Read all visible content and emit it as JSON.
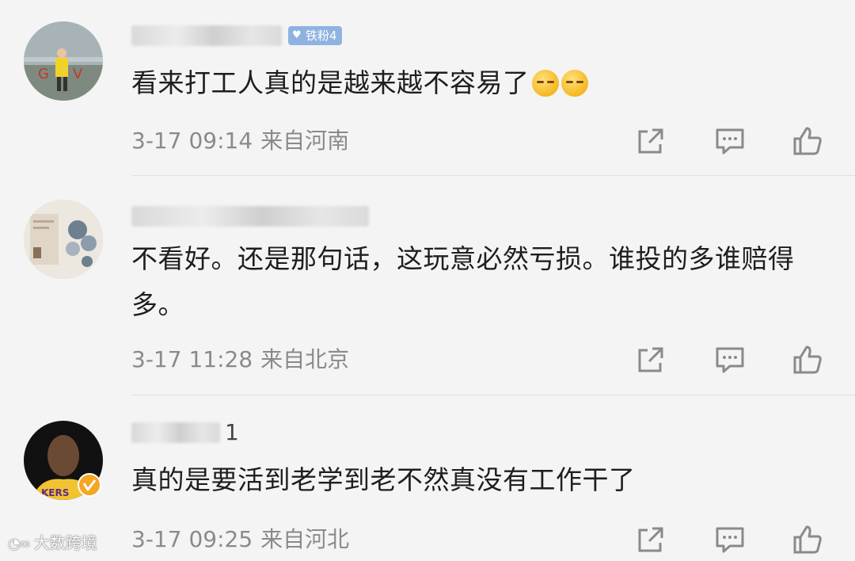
{
  "comments": [
    {
      "badge": "铁粉4",
      "text": "看来打工人真的是越来越不容易了",
      "emoji": [
        "smirk-emoji",
        "smirk-emoji"
      ],
      "time": "3-17 09:14",
      "location": "来自河南"
    },
    {
      "text": "不看好。还是那句话，这玩意必然亏损。谁投的多谁赔得多。",
      "time": "3-17 11:28",
      "location": "来自北京"
    },
    {
      "name_tail": "1",
      "text": "真的是要活到老学到老不然真没有工作干了",
      "time": "3-17 09:25",
      "location": "来自河北"
    }
  ],
  "icons": {
    "share": "share-icon",
    "comment": "comment-icon",
    "like": "like-icon",
    "verified": "verified-badge-icon"
  },
  "watermark": {
    "text": "大数跨境"
  },
  "colors": {
    "background": "#f4f4f4",
    "badge": "#8fb3e0",
    "meta": "#8a8a8a",
    "verified": "#f5a623"
  }
}
